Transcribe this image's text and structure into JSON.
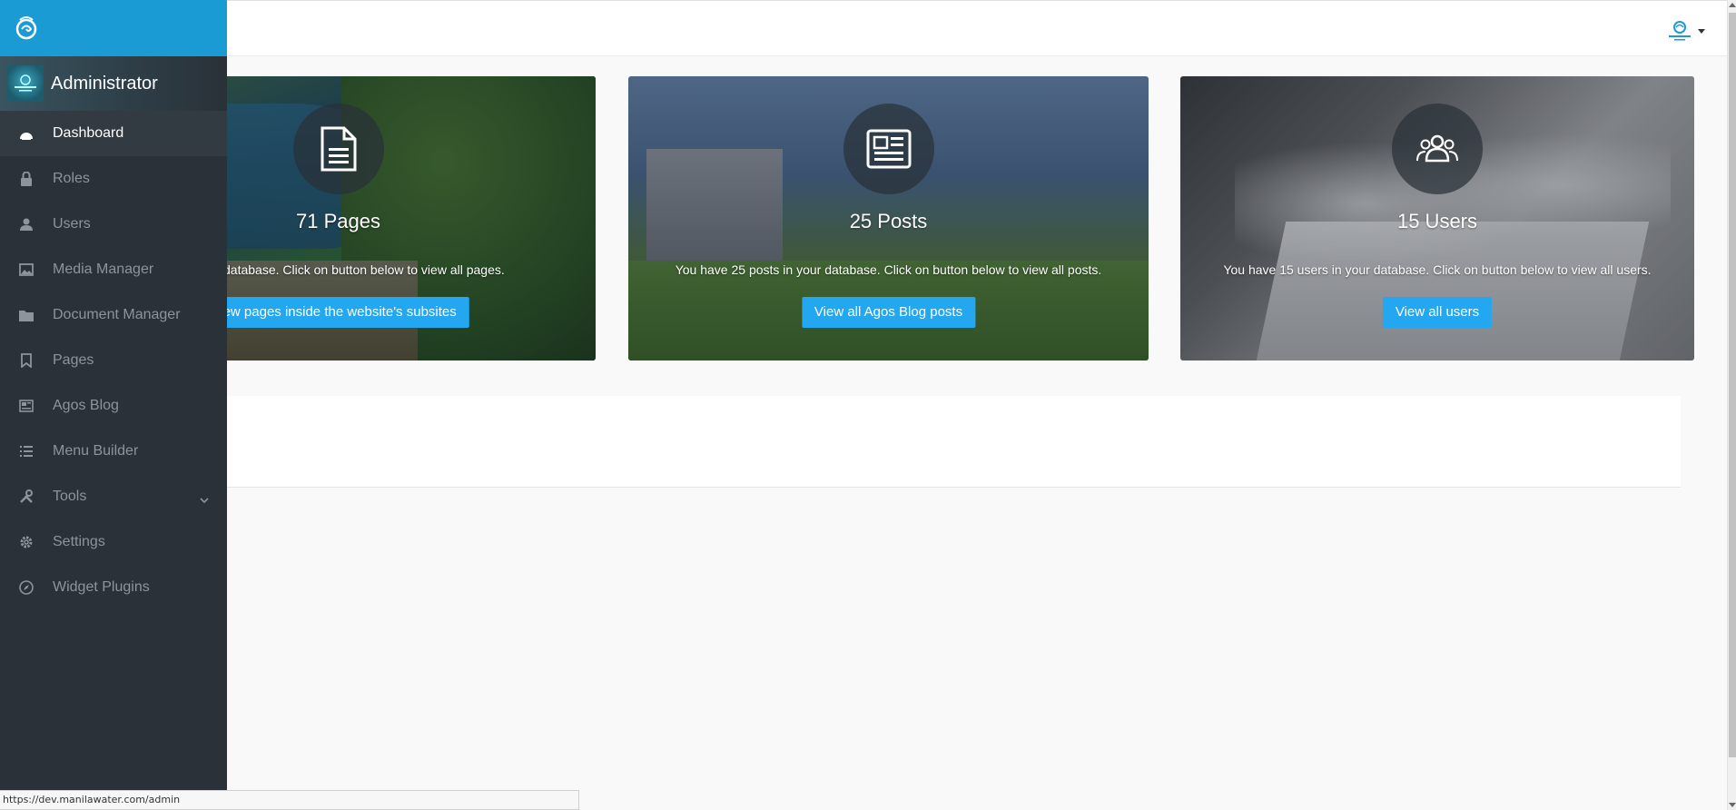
{
  "sidebar": {
    "profile_name": "Administrator",
    "items": [
      {
        "label": "Dashboard",
        "icon": "dashboard-icon",
        "active": true
      },
      {
        "label": "Roles",
        "icon": "lock-icon"
      },
      {
        "label": "Users",
        "icon": "user-icon"
      },
      {
        "label": "Media Manager",
        "icon": "image-icon"
      },
      {
        "label": "Document Manager",
        "icon": "folder-icon"
      },
      {
        "label": "Pages",
        "icon": "bookmark-icon"
      },
      {
        "label": "Agos Blog",
        "icon": "newspaper-icon"
      },
      {
        "label": "Menu Builder",
        "icon": "list-icon"
      },
      {
        "label": "Tools",
        "icon": "tools-icon",
        "has_submenu": true
      },
      {
        "label": "Settings",
        "icon": "gear-icon"
      },
      {
        "label": "Widget Plugins",
        "icon": "compass-icon"
      }
    ]
  },
  "cards": {
    "pages": {
      "count": "71 Pages",
      "description": "s in your database. Click on button below to view all pages.",
      "button": "iew pages inside the website's subsites",
      "icon": "document-icon"
    },
    "posts": {
      "count": "25 Posts",
      "description": "You have 25 posts in your database. Click on button below to view all posts.",
      "button": "View all Agos Blog posts",
      "icon": "newspaper-icon"
    },
    "users": {
      "count": "15 Users",
      "description": "You have 15 users in your database. Click on button below to view all users.",
      "button": "View all users",
      "icon": "group-icon"
    }
  },
  "status_bar": {
    "url": "https://dev.manilawater.com/admin"
  },
  "colors": {
    "accent": "#22a7f0",
    "sidebar_bg": "#2a3138",
    "brand_bar": "#1b9bd4"
  }
}
